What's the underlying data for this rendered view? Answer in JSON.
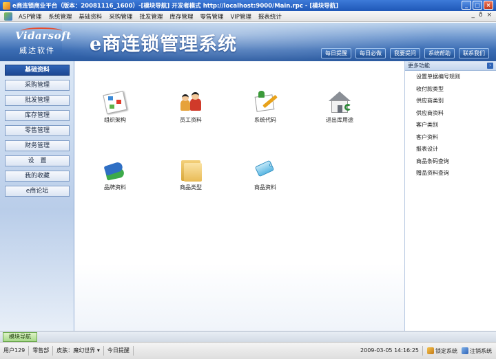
{
  "window": {
    "title": "e商连锁商业平台（版本：20081116_1600）-[模块导航] 开发者模式 http://localhost:9000/Main.rpc - [模块导航]",
    "controls": [
      "_",
      "□",
      "×"
    ]
  },
  "menubar": {
    "items": [
      "ASP管理",
      "系统管理",
      "基础资料",
      "采购管理",
      "批发管理",
      "库存管理",
      "零售管理",
      "VIP管理",
      "报表统计"
    ],
    "controls": [
      "_",
      "ð",
      "×"
    ]
  },
  "banner": {
    "logo_en": "Vidarsoft",
    "logo_cn": "威达软件",
    "system_title": "e商连锁管理系统",
    "quicklinks": [
      "每日提醒",
      "每日必做",
      "我要提问",
      "系统帮助",
      "联系我们"
    ]
  },
  "sidebar": {
    "items": [
      "基础资料",
      "采购管理",
      "批发管理",
      "库存管理",
      "零售管理",
      "财务管理",
      "设　置",
      "我的收藏",
      "e商论坛"
    ]
  },
  "modules": [
    {
      "label": "组织架构",
      "icon": "org-chart-icon"
    },
    {
      "label": "员工资料",
      "icon": "staff-icon"
    },
    {
      "label": "系统代码",
      "icon": "system-code-icon"
    },
    {
      "label": "进出库用途",
      "icon": "warehouse-icon"
    },
    {
      "label": "品牌资料",
      "icon": "brand-tag-icon"
    },
    {
      "label": "商品类型",
      "icon": "folder-icon"
    },
    {
      "label": "商品资料",
      "icon": "product-tag-icon"
    }
  ],
  "right_panel": {
    "header": "更多功能",
    "chevron": "›",
    "links": [
      "设置单据编号规则",
      "收付款类型",
      "供应商类别",
      "供应商资料",
      "客户类别",
      "客户资料",
      "报表设计",
      "商品条码查询",
      "赠品资料查询"
    ]
  },
  "tabs": {
    "active": "模块导航"
  },
  "status": {
    "user": "用户129",
    "department": "零售部",
    "skin": "皮肤：魔幻世界 ▾",
    "reminder": "今日提醒",
    "datetime": "2009-03-05 14:16:25",
    "lock": "锁定系统",
    "logout": "注销系统"
  },
  "colors": {
    "accent": "#2f64b7",
    "banner": "#3b6db4",
    "active_tab": "#a7d98a"
  }
}
